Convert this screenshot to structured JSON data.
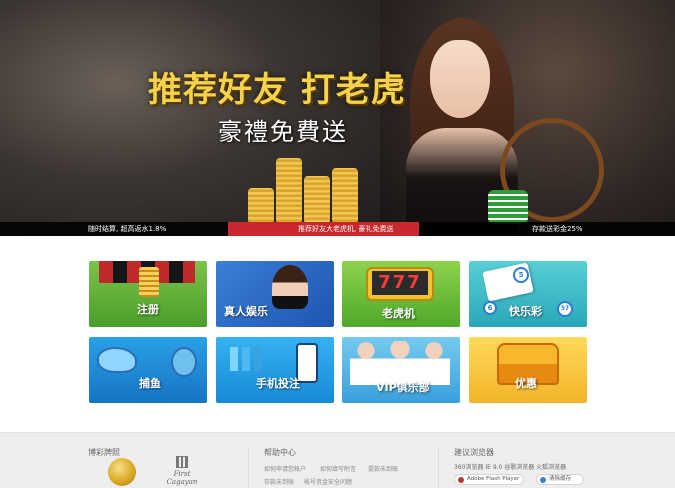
{
  "banner": {
    "headline": "推荐好友 打老虎",
    "subline": "豪禮免費送",
    "ticker": {
      "left": "随时结算, 超高返水1.8%",
      "center": "推荐好友大老虎机, 豪礼免费送",
      "right": "存款送彩金25%"
    }
  },
  "tiles": [
    {
      "label": "注册"
    },
    {
      "label": "真人娱乐"
    },
    {
      "label": "老虎机",
      "reel": "777"
    },
    {
      "label": "快乐彩",
      "balls": [
        "5",
        "6",
        "57"
      ]
    },
    {
      "label": "捕鱼"
    },
    {
      "label": "手机投注"
    },
    {
      "label": "VIP俱乐部"
    },
    {
      "label": "优惠"
    }
  ],
  "footer": {
    "col1": {
      "title": "博彩牌照",
      "seal_text": "First Cagayan"
    },
    "col2": {
      "title": "帮助中心",
      "links": [
        "如何申请您帐户",
        "如何填写附言",
        "提款未到账",
        "存款未到账",
        "帐号资金安全问题"
      ]
    },
    "col3": {
      "title": "建议浏览器",
      "browsers_text": "360浏览器 IE 9.0 谷歌浏览器 火狐浏览器",
      "buttons": [
        "Adobe Flash Player",
        "清除缓存"
      ]
    }
  },
  "colors": {
    "ticker_bg": "#000000",
    "ticker_highlight": "#c8282d",
    "headline": "#f4d24a",
    "footer_bg": "#eeeeee"
  }
}
